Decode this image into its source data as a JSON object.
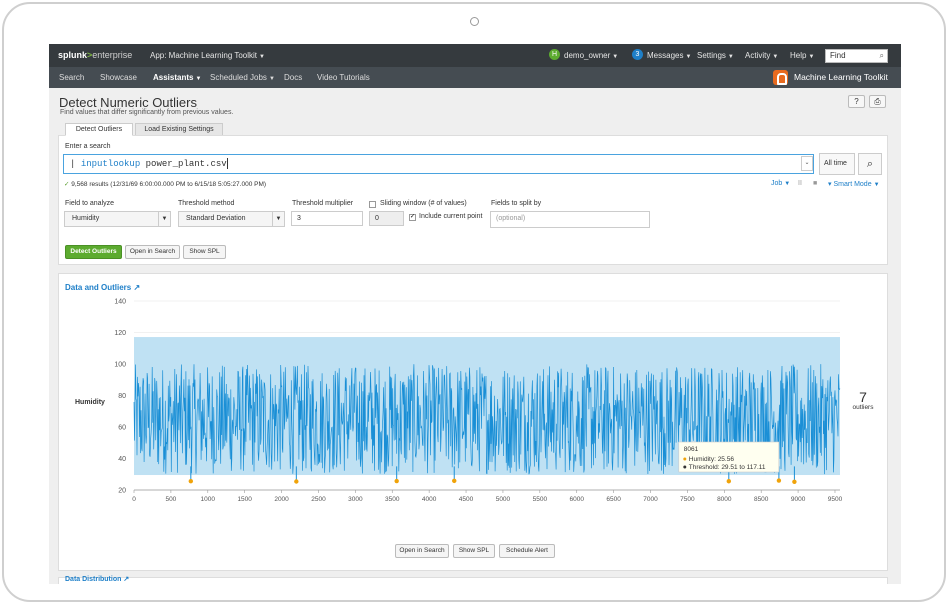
{
  "topbar": {
    "logo_main": "splunk",
    "logo_sep": ">",
    "logo_sub": "enterprise",
    "app_menu": "App: Machine Learning Toolkit",
    "user_initial": "H",
    "user": "demo_owner",
    "messages_count": "3",
    "messages": "Messages",
    "settings": "Settings",
    "activity": "Activity",
    "help": "Help",
    "find_placeholder": "Find"
  },
  "appbar": {
    "nav": [
      "Search",
      "Showcase",
      "Assistants",
      "Scheduled Jobs",
      "Docs",
      "Video Tutorials"
    ],
    "app_title": "Machine Learning Toolkit"
  },
  "page": {
    "title": "Detect Numeric Outliers",
    "subtitle": "Find values that differ significantly from previous values.",
    "help_btn": "?",
    "print_btn": "⎙"
  },
  "tabs": [
    "Detect Outliers",
    "Load Existing Settings"
  ],
  "search": {
    "label": "Enter a search",
    "pipe": "|",
    "command": "inputlookup",
    "argument": "power_plant.csv",
    "time_range": "All time",
    "status": "9,568 results (12/31/69 6:00:00.000 PM to 6/15/18 5:05:27.000 PM)",
    "job": "Job",
    "pause": "II",
    "stop": "■",
    "mode": "Smart Mode"
  },
  "form": {
    "field_label": "Field to analyze",
    "field_value": "Humidity",
    "method_label": "Threshold method",
    "method_value": "Standard Deviation",
    "multiplier_label": "Threshold multiplier",
    "multiplier_value": "3",
    "window_label": "Sliding window (# of values)",
    "window_value": "0",
    "include_label": "Include current point",
    "split_label": "Fields to split by",
    "split_placeholder": "(optional)"
  },
  "actions": {
    "detect": "Detect Outliers",
    "open_search": "Open in Search",
    "show_spl": "Show SPL"
  },
  "chart_panel": {
    "title": "Data and Outliers",
    "outlier_count": "7",
    "outlier_label": "outliers",
    "open_search": "Open in Search",
    "show_spl": "Show SPL",
    "schedule_alert": "Schedule Alert"
  },
  "next_panel": {
    "title": "Data Distribution"
  },
  "colors": {
    "series": "#1a8fd6",
    "band": "#bfe1f3",
    "outlier": "#f0a30a",
    "accent": "#1e7fc8",
    "primary_btn": "#5cab2f"
  },
  "chart_data": {
    "type": "line",
    "ylabel": "Humidity",
    "xlim": [
      0,
      9568
    ],
    "ylim": [
      20,
      140
    ],
    "xticks": [
      0,
      500,
      1000,
      1500,
      2000,
      2500,
      3000,
      3500,
      4000,
      4500,
      5000,
      5500,
      6000,
      6500,
      7000,
      7500,
      8000,
      8500,
      9000,
      9500
    ],
    "yticks": [
      20,
      40,
      60,
      80,
      100,
      120,
      140
    ],
    "series": [
      {
        "name": "Humidity",
        "range": [
          30,
          100
        ]
      }
    ],
    "threshold_band": [
      29.51,
      117.11
    ],
    "outliers": [
      {
        "x": 770,
        "y": 25.6
      },
      {
        "x": 2200,
        "y": 25.4
      },
      {
        "x": 3560,
        "y": 25.7
      },
      {
        "x": 4340,
        "y": 25.8
      },
      {
        "x": 8061,
        "y": 25.56
      },
      {
        "x": 8740,
        "y": 26.0
      },
      {
        "x": 8950,
        "y": 25.2
      }
    ],
    "tooltip": {
      "x": "8061",
      "value_line": "Humidity: 25.56",
      "threshold_line": "Threshold: 29.51 to 117.11"
    }
  }
}
